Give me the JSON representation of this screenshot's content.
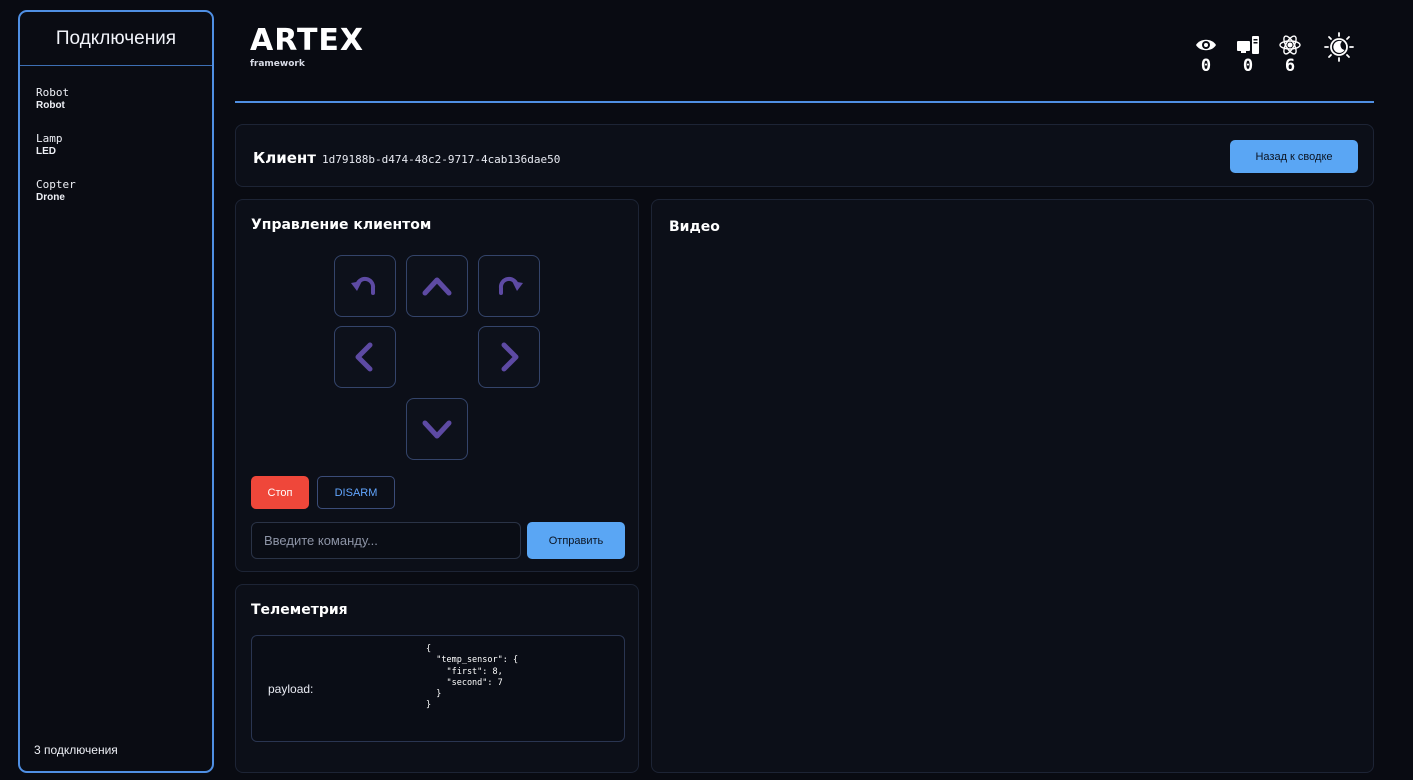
{
  "sidebar": {
    "title": "Подключения",
    "connections": [
      {
        "name": "Robot",
        "type": "Robot"
      },
      {
        "name": "Lamp",
        "type": "LED"
      },
      {
        "name": "Copter",
        "type": "Drone"
      }
    ],
    "count_label": "3 подключения"
  },
  "header": {
    "logo_title": "ARTEX",
    "logo_subtitle": "framework",
    "stats": [
      {
        "icon": "eye-icon",
        "value": "0"
      },
      {
        "icon": "computer-icon",
        "value": "0"
      },
      {
        "icon": "atom-icon",
        "value": "6"
      }
    ],
    "theme_icon": "sun-moon-icon"
  },
  "client": {
    "label": "Клиент",
    "id": "1d79188b-d474-48c2-9717-4cab136dae50",
    "back_button": "Назад к сводке"
  },
  "control": {
    "title": "Управление клиентом",
    "buttons": {
      "rotate_left": "rotate-left-icon",
      "forward": "chevron-up-icon",
      "rotate_right": "rotate-right-icon",
      "left": "chevron-left-icon",
      "right": "chevron-right-icon",
      "backward": "chevron-down-icon"
    },
    "stop_label": "Стоп",
    "disarm_label": "DISARM",
    "command_placeholder": "Введите команду...",
    "send_label": "Отправить"
  },
  "telemetry": {
    "title": "Телеметрия",
    "payload_label": "payload:",
    "payload_json": "{\n  \"temp_sensor\": {\n    \"first\": 8,\n    \"second\": 7\n  }\n}"
  },
  "video": {
    "title": "Видео"
  },
  "colors": {
    "accent": "#4f8fe3",
    "primary_button": "#5aa6f4",
    "stop_button": "#ef473a",
    "control_arrow": "#5d4aa3",
    "background": "#090b12",
    "panel": "#0c0f18"
  }
}
